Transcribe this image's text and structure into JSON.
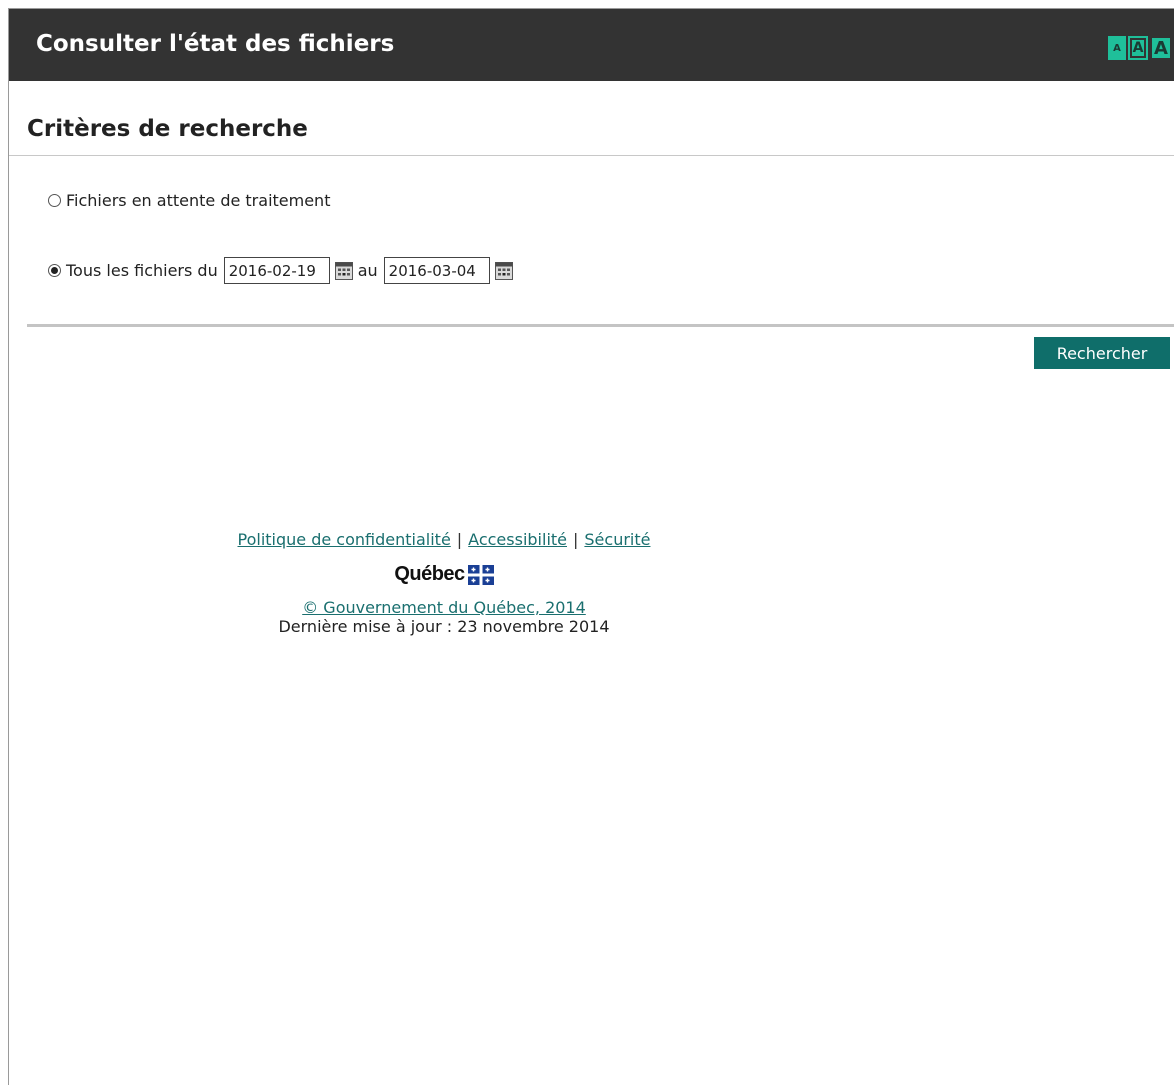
{
  "header": {
    "title": "Consulter l'état des fichiers",
    "font_size_controls": [
      "A",
      "A",
      "A"
    ]
  },
  "search_criteria": {
    "title": "Critères de recherche",
    "option_pending": {
      "label": "Fichiers en attente de traitement",
      "selected": false
    },
    "option_all": {
      "label": "Tous les fichiers du",
      "selected": true,
      "date_from": "2016-02-19",
      "to_label": "au",
      "date_to": "2016-03-04"
    },
    "search_button": "Rechercher"
  },
  "footer": {
    "links": [
      "Politique de confidentialité",
      "Accessibilité",
      "Sécurité"
    ],
    "separator": "|",
    "logo_text": "Québec",
    "copyright": "© Gouvernement du Québec, 2014",
    "last_update": "Dernière mise à jour : 23 novembre 2014"
  },
  "colors": {
    "header_bg": "#333333",
    "accent_button": "#0f6e6a",
    "font_control_green": "#1fbf9a",
    "link": "#1a6f6f",
    "flag_blue": "#1a3f95"
  },
  "icons": {
    "calendar": "calendar-icon",
    "quebec_flag": "quebec-flag-icon"
  }
}
